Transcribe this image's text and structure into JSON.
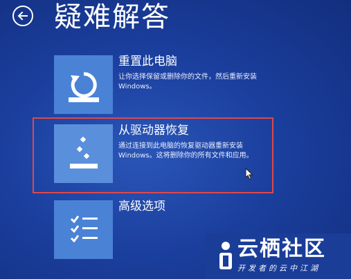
{
  "header": {
    "title": "疑难解答",
    "back_icon": "back-arrow-icon"
  },
  "options": [
    {
      "id": "reset",
      "icon": "refresh-pc-icon",
      "title": "重置此电脑",
      "description": "让你选择保留或删除你的文件，然后重新安装 Windows。"
    },
    {
      "id": "recover",
      "icon": "recover-from-drive-icon",
      "title": "从驱动器恢复",
      "description": "通过连接到此电脑的恢复驱动器重新安装 Windows。这将删除你的所有文件和应用。"
    },
    {
      "id": "advanced",
      "icon": "checklist-icon",
      "title": "高级选项",
      "description": ""
    }
  ],
  "watermark": {
    "title": "云栖社区",
    "subtitle": "开发者的云中江湖"
  },
  "colors": {
    "background": "#1b3f9e",
    "tile": "#4a82d6",
    "highlight": "#e04848"
  }
}
